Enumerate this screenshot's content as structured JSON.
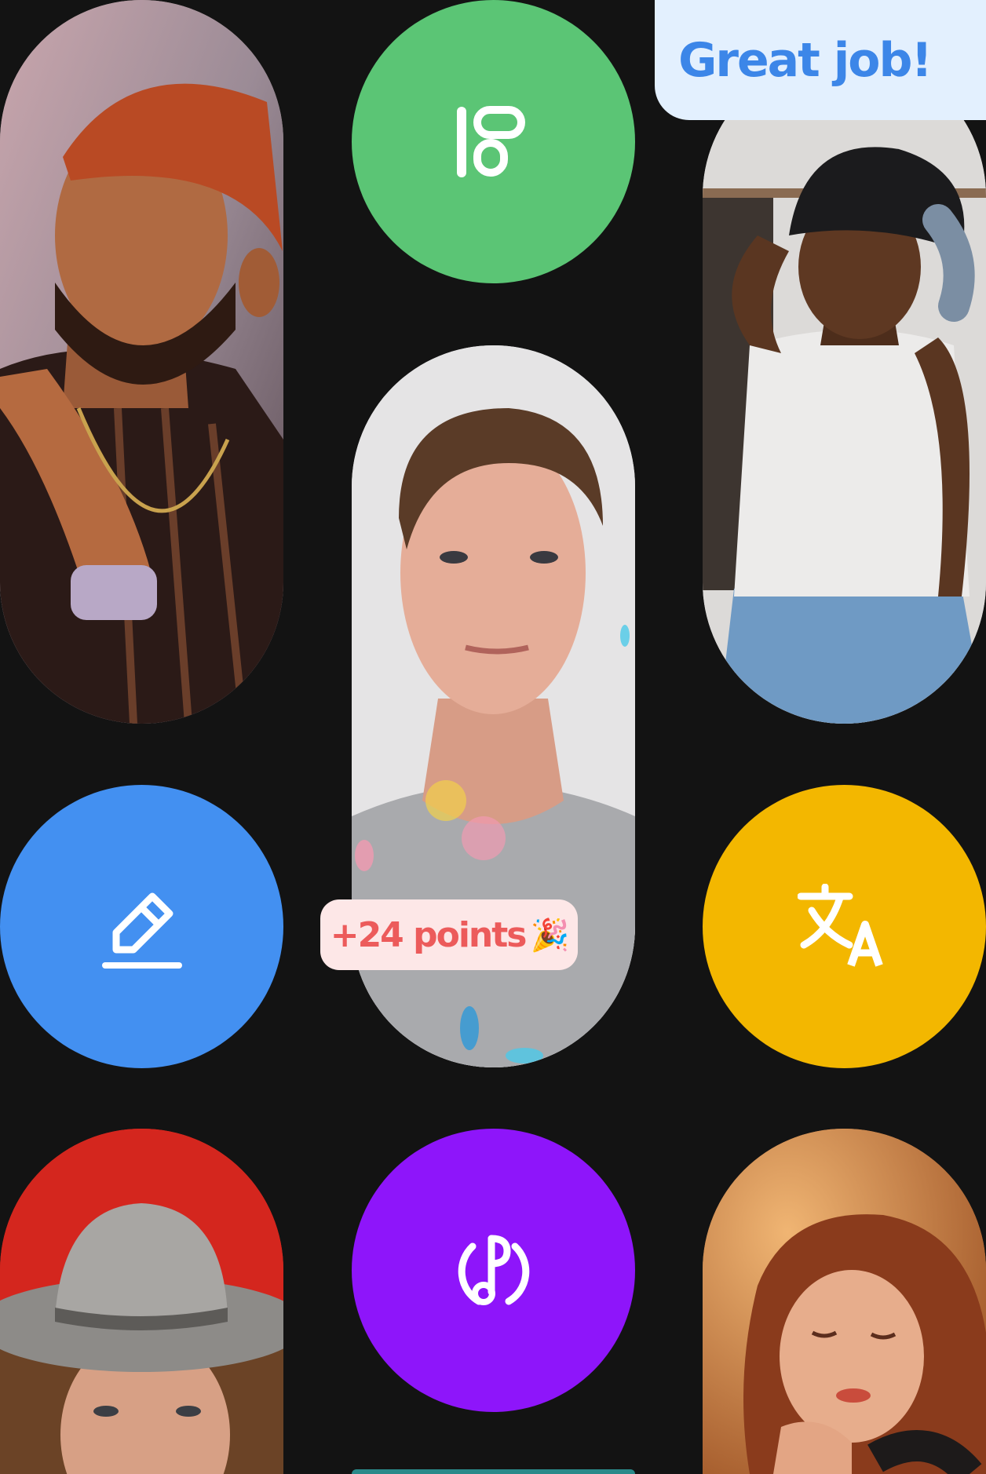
{
  "colors": {
    "background": "#131313",
    "green": "#5BC575",
    "blue": "#4390F1",
    "yellow": "#F3B700",
    "purple": "#8E15FA",
    "great_job_bg": "#E3F0FE",
    "great_job_text": "#3C86E8",
    "points_bg": "#FDE7E7",
    "points_text": "#EC5B5B"
  },
  "toasts": {
    "great_job": "Great job!",
    "points": "+24 points",
    "points_emoji": "🎉"
  },
  "icons": {
    "green_tile": "layout-dashboard-icon",
    "blue_tile": "pencil-edit-icon",
    "yellow_tile": "translate-icon",
    "purple_tile": "music-note-circle-icon"
  },
  "photos": [
    "man-orange-beanie-photo",
    "young-man-grey-sweatshirt-photo",
    "woman-black-beanie-headphones-photo",
    "man-grey-hat-red-background-photo",
    "woman-red-hair-headphones-photo"
  ]
}
